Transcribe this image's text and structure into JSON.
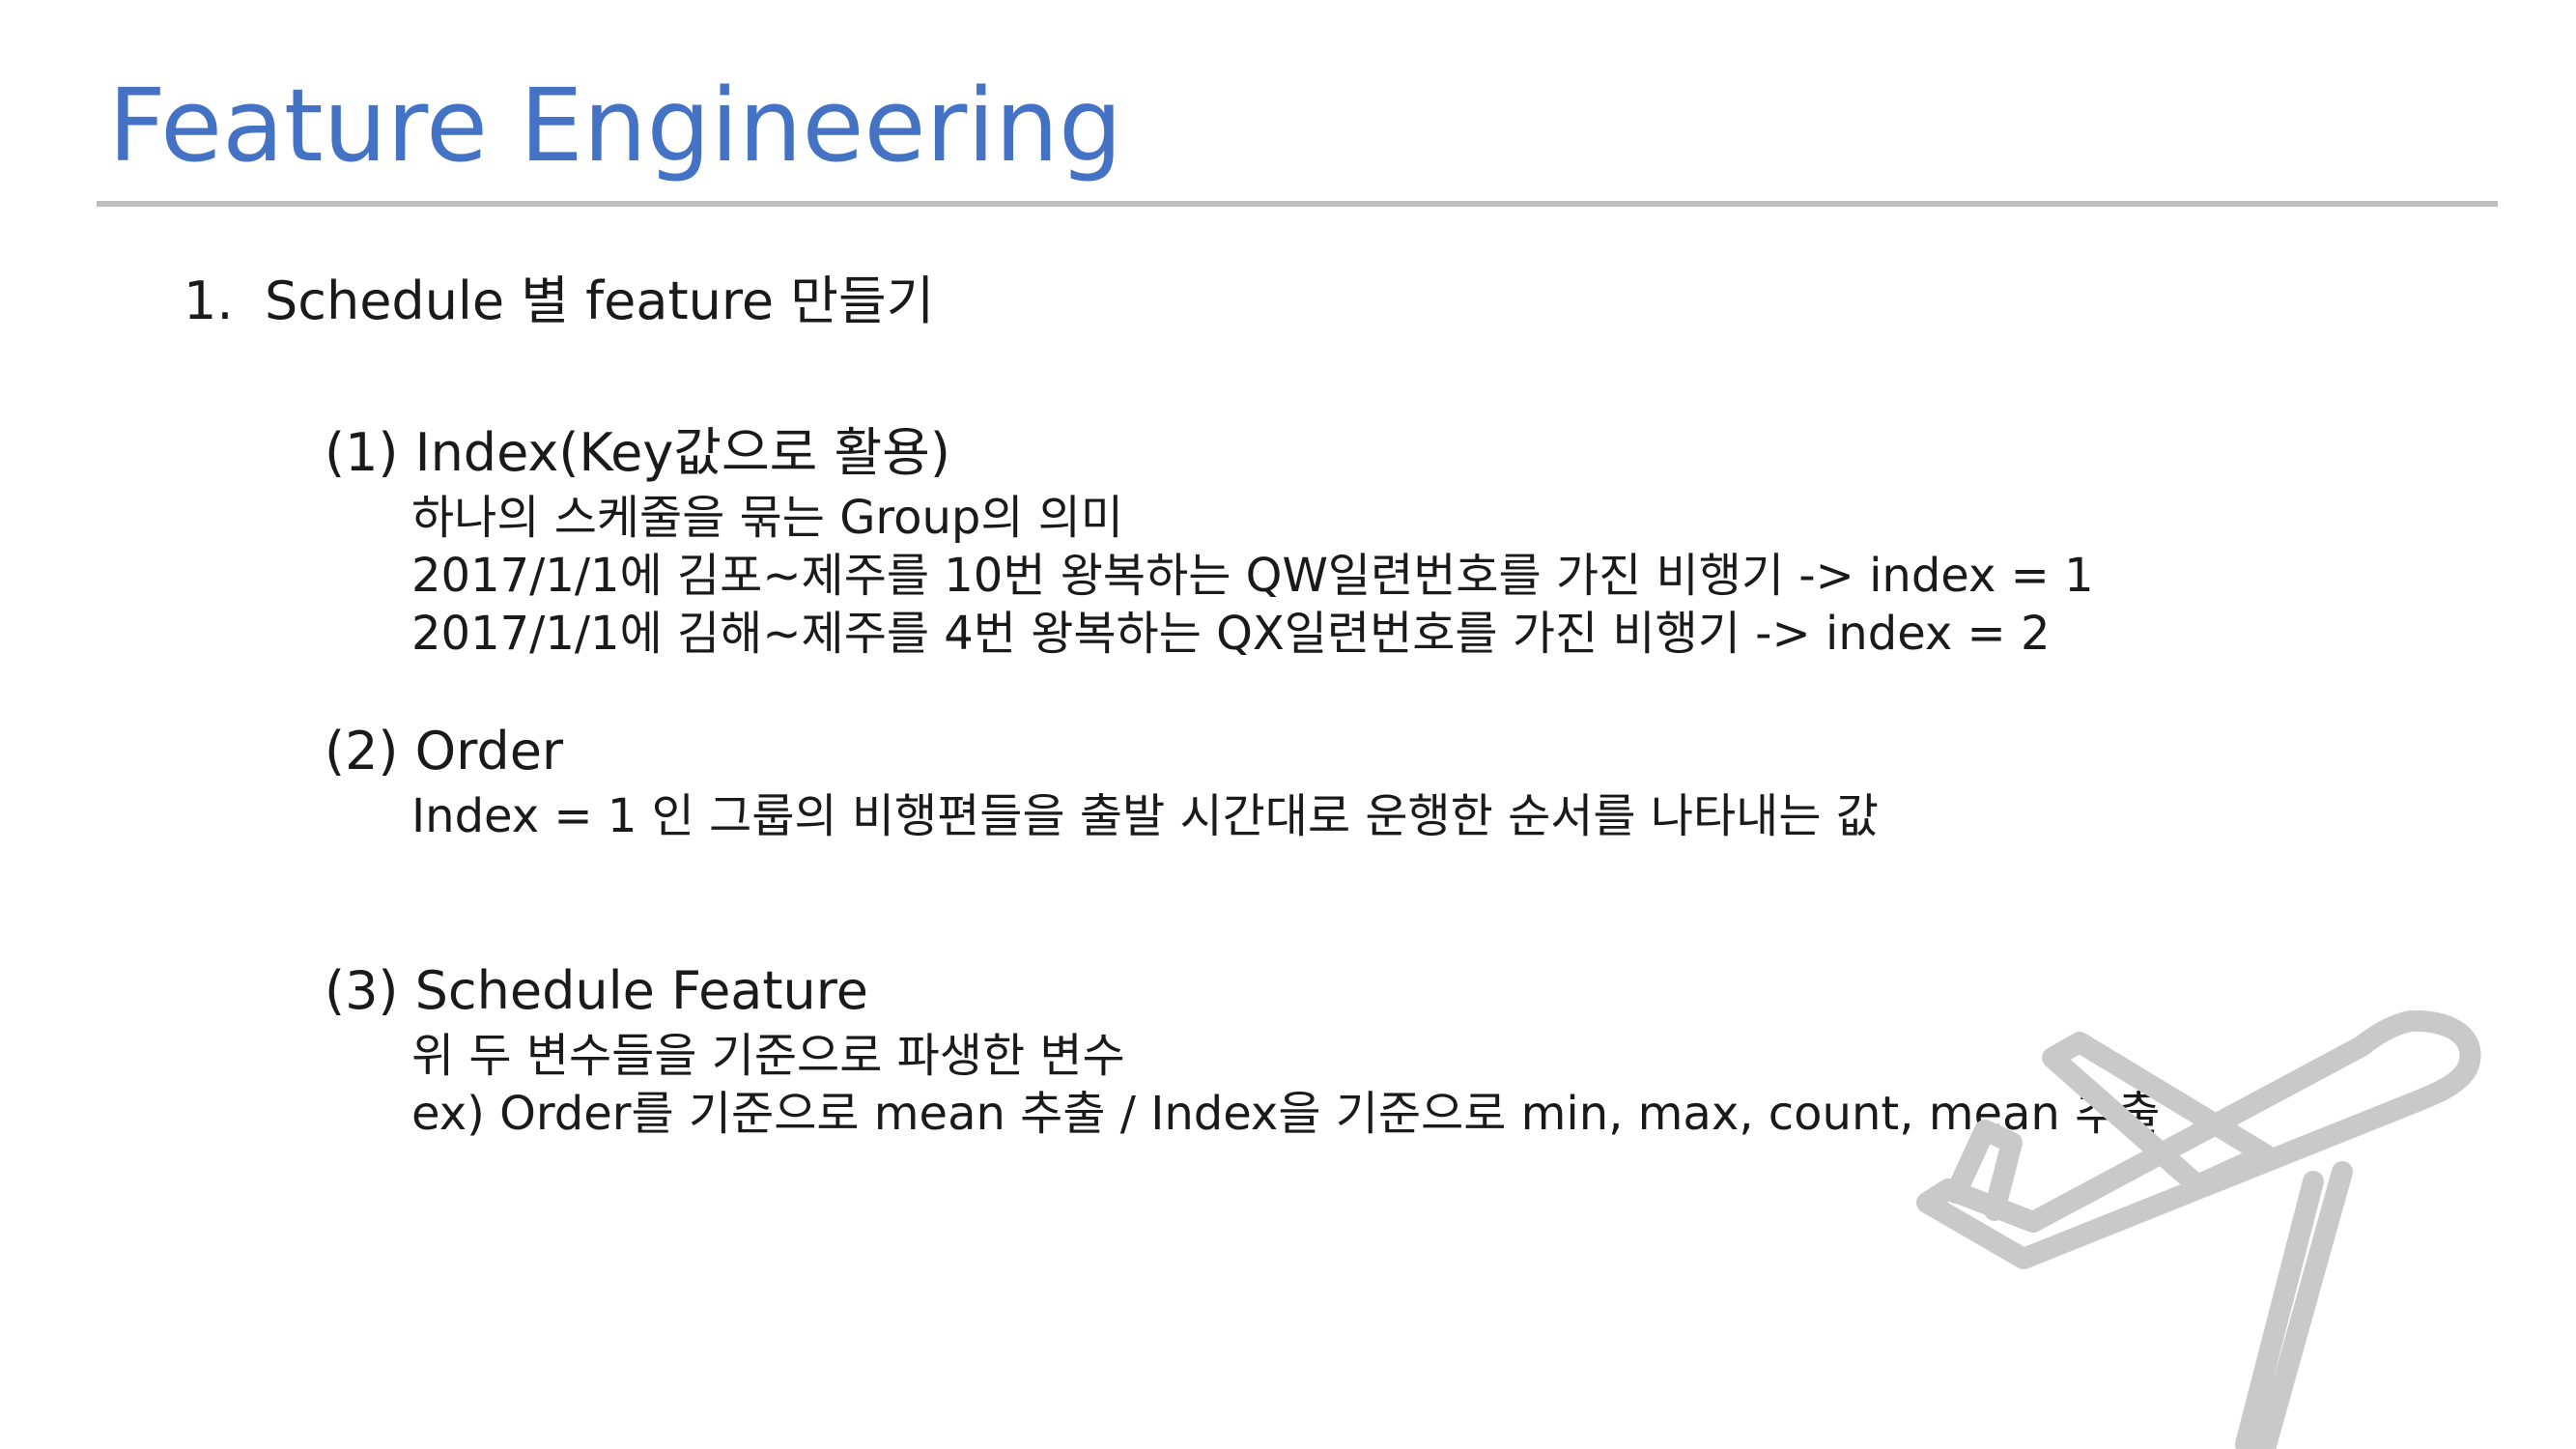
{
  "slide": {
    "title": "Feature Engineering",
    "accent_color": "#4472c4",
    "rule_color": "#bfbfbf"
  },
  "heading": {
    "number": "1.",
    "text": "Schedule 별 feature 만들기"
  },
  "sections": [
    {
      "title": "(1) Index(Key값으로 활용)",
      "lines": [
        "하나의 스케줄을 묶는 Group의 의미",
        "2017/1/1에 김포~제주를 10번 왕복하는 QW일련번호를 가진 비행기 -> index = 1",
        "2017/1/1에 김해~제주를 4번 왕복하는 QX일련번호를 가진 비행기 -> index = 2"
      ]
    },
    {
      "title": "(2) Order",
      "lines": [
        "Index = 1 인 그룹의 비행편들을 출발 시간대로 운행한 순서를 나타내는 값"
      ]
    },
    {
      "title": "(3) Schedule Feature",
      "lines": [
        "위 두 변수들을 기준으로 파생한 변수",
        "ex) Order를 기준으로 mean 추출 / Index을 기준으로 min, max, count, mean 추출"
      ]
    }
  ],
  "decoration": {
    "icon": "airplane-icon",
    "color": "#c9c9c9"
  }
}
